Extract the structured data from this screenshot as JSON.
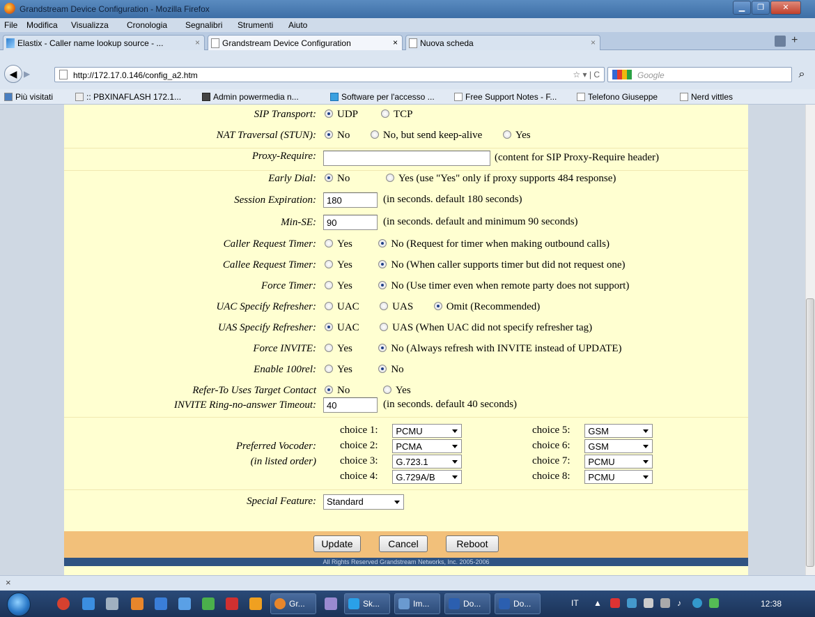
{
  "window": {
    "title": "Grandstream Device Configuration - Mozilla Firefox"
  },
  "menu": [
    "File",
    "Modifica",
    "Visualizza",
    "Cronologia",
    "Segnalibri",
    "Strumenti",
    "Aiuto"
  ],
  "tabs": [
    {
      "label": "Elastix - Caller name lookup source - ..."
    },
    {
      "label": "Grandstream Device Configuration"
    },
    {
      "label": "Nuova scheda"
    }
  ],
  "nav": {
    "url": "http://172.17.0.146/config_a2.htm",
    "search_placeholder": "Google"
  },
  "bookmarks": [
    "Più visitati",
    ":: PBXINAFLASH 172.1...",
    "Admin powermedia n...",
    "Software per l'accesso ...",
    "Free Support Notes - F...",
    "Telefono Giuseppe",
    "Nerd vittles"
  ],
  "form": {
    "sip_transport": {
      "label": "SIP Transport:",
      "opt1": "UDP",
      "opt2": "TCP"
    },
    "nat": {
      "label": "NAT Traversal (STUN):",
      "opt1": "No",
      "opt2": "No, but send keep-alive",
      "opt3": "Yes"
    },
    "proxy_require": {
      "label": "Proxy-Require:",
      "value": "",
      "note": "(content for SIP Proxy-Require header)"
    },
    "early_dial": {
      "label": "Early Dial:",
      "opt1": "No",
      "opt2": "Yes (use \"Yes\" only if proxy supports 484 response)"
    },
    "session_exp": {
      "label": "Session Expiration:",
      "value": "180",
      "note": "(in seconds. default 180 seconds)"
    },
    "min_se": {
      "label": "Min-SE:",
      "value": "90",
      "note": "(in seconds. default and minimum 90 seconds)"
    },
    "caller_timer": {
      "label": "Caller Request Timer:",
      "opt1": "Yes",
      "opt2": "No (Request for timer when making outbound calls)"
    },
    "callee_timer": {
      "label": "Callee Request Timer:",
      "opt1": "Yes",
      "opt2": "No (When caller supports timer but did not request one)"
    },
    "force_timer": {
      "label": "Force Timer:",
      "opt1": "Yes",
      "opt2": "No (Use timer even when remote party does not support)"
    },
    "uac_refresher": {
      "label": "UAC Specify Refresher:",
      "opt1": "UAC",
      "opt2": "UAS",
      "opt3": "Omit (Recommended)"
    },
    "uas_refresher": {
      "label": "UAS Specify Refresher:",
      "opt1": "UAC",
      "opt2": "UAS (When UAC did not specify refresher tag)"
    },
    "force_invite": {
      "label": "Force INVITE:",
      "opt1": "Yes",
      "opt2": "No (Always refresh with INVITE instead of UPDATE)"
    },
    "enable_100rel": {
      "label": "Enable 100rel:",
      "opt1": "Yes",
      "opt2": "No"
    },
    "refer_to": {
      "label": "Refer-To Uses Target Contact",
      "opt1": "No",
      "opt2": "Yes"
    },
    "ring_timeout": {
      "label": "INVITE Ring-no-answer Timeout:",
      "value": "40",
      "note": "(in seconds. default 40 seconds)"
    },
    "vocoder": {
      "label1": "Preferred Vocoder:",
      "label2": "(in listed order)",
      "choices": [
        {
          "label": "choice 1:",
          "value": "PCMU"
        },
        {
          "label": "choice 2:",
          "value": "PCMA"
        },
        {
          "label": "choice 3:",
          "value": "G.723.1"
        },
        {
          "label": "choice 4:",
          "value": "G.729A/B"
        },
        {
          "label": "choice 5:",
          "value": "GSM"
        },
        {
          "label": "choice 6:",
          "value": "GSM"
        },
        {
          "label": "choice 7:",
          "value": "PCMU"
        },
        {
          "label": "choice 8:",
          "value": "PCMU"
        }
      ]
    },
    "special_feature": {
      "label": "Special Feature:",
      "value": "Standard"
    }
  },
  "buttons": {
    "update": "Update",
    "cancel": "Cancel",
    "reboot": "Reboot"
  },
  "copyright": "All Rights Reserved Grandstream Networks, Inc. 2005-2006",
  "taskbar": {
    "tasks": [
      "Gr...",
      "Sk...",
      "Im...",
      "Do...",
      "Do..."
    ],
    "lang": "IT",
    "clock": "12:38"
  }
}
